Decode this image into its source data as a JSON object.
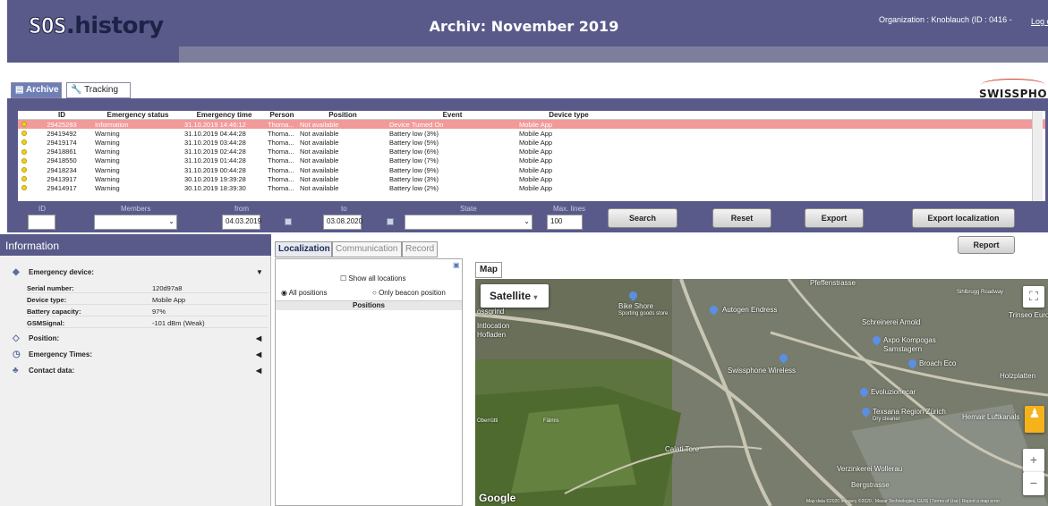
{
  "header": {
    "logo_prefix": "SOS",
    "logo_suffix": ".history",
    "title": "Archiv: November 2019",
    "organization": "Organization : Knoblauch (ID : 0416 -",
    "logout": "Log o"
  },
  "tabs": [
    {
      "label": "Archive",
      "icon": "archive-icon",
      "active": true
    },
    {
      "label": "Tracking",
      "icon": "wrench-icon",
      "active": false
    }
  ],
  "brand": "SWISSPHONE",
  "grid": {
    "columns": [
      "ID",
      "Emergency status",
      "Emergency time",
      "Person",
      "Position",
      "Event",
      "Device type"
    ],
    "rows": [
      [
        "29425283",
        "Information",
        "31.10.2019 14:46:12",
        "Thoma...",
        "Not available",
        "Device Turned On",
        "Mobile App"
      ],
      [
        "29419492",
        "Warning",
        "31.10.2019 04:44:28",
        "Thoma...",
        "Not available",
        "Battery low (3%)",
        "Mobile App"
      ],
      [
        "29419174",
        "Warning",
        "31.10.2019 03:44:28",
        "Thoma...",
        "Not available",
        "Battery low (5%)",
        "Mobile App"
      ],
      [
        "29418861",
        "Warning",
        "31.10.2019 02:44:28",
        "Thoma...",
        "Not available",
        "Battery low (6%)",
        "Mobile App"
      ],
      [
        "29418550",
        "Warning",
        "31.10.2019 01:44:28",
        "Thoma...",
        "Not available",
        "Battery low (7%)",
        "Mobile App"
      ],
      [
        "29418234",
        "Warning",
        "31.10.2019 00:44:28",
        "Thoma...",
        "Not available",
        "Battery low (9%)",
        "Mobile App"
      ],
      [
        "29413917",
        "Warning",
        "30.10.2019 19:39:28",
        "Thoma...",
        "Not available",
        "Battery low (3%)",
        "Mobile App"
      ],
      [
        "29414917",
        "Warning",
        "30.10.2019 18:39:30",
        "Thoma...",
        "Not available",
        "Battery low (2%)",
        "Mobile App"
      ]
    ],
    "selected_row": 0
  },
  "filters": {
    "id_label": "ID",
    "members_label": "Members",
    "from_label": "from",
    "to_label": "to",
    "state_label": "State",
    "maxlines_label": "Max. lines",
    "from_value": "04.03.2019",
    "to_value": "03.08.2020",
    "maxlines_value": "100"
  },
  "buttons": {
    "search": "Search",
    "reset": "Reset",
    "export": "Export",
    "export_loc": "Export localization",
    "report": "Report"
  },
  "info": {
    "header": "Information",
    "sections": [
      "Emergency device:",
      "Position:",
      "Emergency Times:",
      "Contact data:"
    ],
    "fields": [
      {
        "k": "Serial number:",
        "v": "120d97a8"
      },
      {
        "k": "Device type:",
        "v": "Mobile App"
      },
      {
        "k": "Battery capacity:",
        "v": "97%"
      },
      {
        "k": "GSMSignal:",
        "v": "-101 dBm (Weak)"
      }
    ]
  },
  "mid": {
    "tabs": [
      "Localization",
      "Communication",
      "Record"
    ],
    "show_all": "Show all locations",
    "all_positions": "All positions",
    "beacon": "Only beacon position",
    "positions_header": "Positions"
  },
  "map": {
    "tab": "Map",
    "type": "Satellite",
    "google": "Google",
    "attribution": "Map data ©2020 Imagery ©2020 , Maxar Technologies, GUIS | Terms of Use | Report a map error",
    "labels": [
      "Bike Shore",
      "Sporting goods store",
      "Autogen Endress",
      "Schreinerei Arnold",
      "Trinseo Europe",
      "Axpo Kompogas",
      "Samstagern",
      "Broach Eco",
      "Holzplatten",
      "Swissphone Wireless",
      "Evoluzionecar",
      "Texsana Region Zürich",
      "Dry cleaner",
      "Hemair Luftkanals",
      "Calati Tore",
      "Verzinkerei Wollerau",
      "Bergstrasse",
      "Oberrütti",
      "Fälmis",
      "Intlocation",
      "Hofladen",
      "ossgrind",
      "Pfeffenstrasse",
      "Sihlbrugg Roadway"
    ]
  }
}
